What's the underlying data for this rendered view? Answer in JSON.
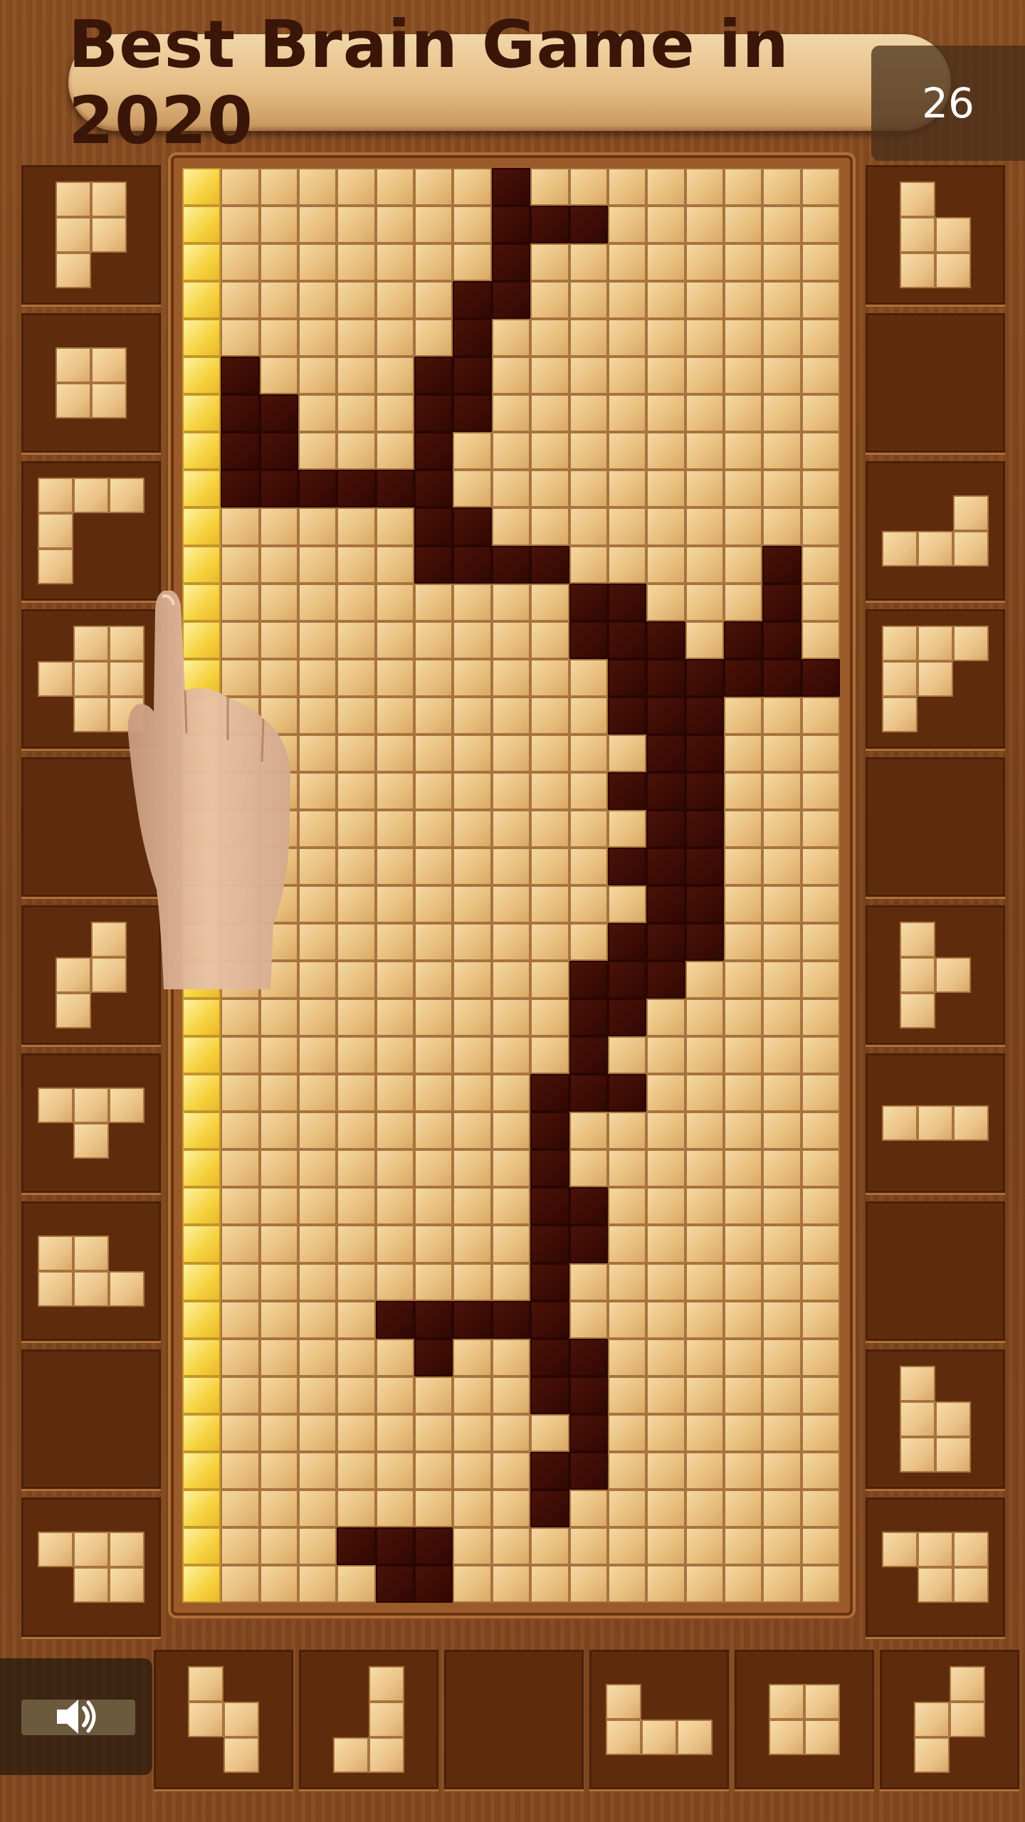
{
  "header": {
    "title": "Best Brain Game in 2020"
  },
  "counter": {
    "value": "26"
  },
  "board": {
    "cols": 17,
    "rows": 38,
    "rows_data": [
      "Y.......D........",
      "Y.......DDD......",
      "Y.......D........",
      "Y......DD........",
      "Y......D.........",
      "YD....DD.........",
      "YDD...DD.........",
      "YDD...D..........",
      "YDDDDDD..........",
      "Y.....DD.........",
      "Y.....DDDD.....D.",
      "Y.........DD...D.",
      "Y.........DDD.DD.",
      "Y..........DDDDDD",
      "Y..........DDD...",
      "Y...........DD...",
      "Y..........DDD...",
      "Y...........DD...",
      "Y..........DDD...",
      "Y...........DD...",
      "Y..........DDD...",
      "Y.........DDD....",
      "Y.........DD.....",
      "Y.........D......",
      "Y........DDD.....",
      "Y........D.......",
      "Y........D.......",
      "Y........DD......",
      "Y........DD......",
      "Y........D.......",
      "Y....DDDDD.......",
      "Y.....D..DD......",
      "Y........DD......",
      "Y.........D......",
      "Y........DD......",
      "Y........D.......",
      "Y...DDD..........",
      "Y....DD.........."
    ]
  },
  "left_tray": [
    {
      "name": "piece-p",
      "cells": [
        [
          0,
          0
        ],
        [
          1,
          0
        ],
        [
          0,
          1
        ],
        [
          1,
          1
        ],
        [
          0,
          2
        ]
      ]
    },
    {
      "name": "piece-square",
      "cells": [
        [
          0,
          0
        ],
        [
          1,
          0
        ],
        [
          0,
          1
        ],
        [
          1,
          1
        ]
      ]
    },
    {
      "name": "piece-big-l",
      "cells": [
        [
          0,
          0
        ],
        [
          1,
          0
        ],
        [
          2,
          0
        ],
        [
          0,
          1
        ],
        [
          0,
          2
        ]
      ]
    },
    {
      "name": "piece-plus",
      "cells": [
        [
          1,
          0
        ],
        [
          2,
          0
        ],
        [
          0,
          1
        ],
        [
          1,
          1
        ],
        [
          2,
          1
        ],
        [
          1,
          2
        ],
        [
          2,
          2
        ]
      ]
    },
    {
      "name": "empty",
      "cells": []
    },
    {
      "name": "piece-s-vert",
      "cells": [
        [
          1,
          0
        ],
        [
          0,
          1
        ],
        [
          1,
          1
        ],
        [
          0,
          2
        ]
      ]
    },
    {
      "name": "piece-t",
      "cells": [
        [
          0,
          0
        ],
        [
          1,
          0
        ],
        [
          2,
          0
        ],
        [
          1,
          1
        ]
      ]
    },
    {
      "name": "piece-p-flat",
      "cells": [
        [
          0,
          0
        ],
        [
          1,
          0
        ],
        [
          0,
          1
        ],
        [
          1,
          1
        ],
        [
          2,
          1
        ]
      ]
    },
    {
      "name": "empty",
      "cells": []
    },
    {
      "name": "piece-z-wide",
      "cells": [
        [
          0,
          0
        ],
        [
          1,
          0
        ],
        [
          2,
          0
        ],
        [
          1,
          1
        ],
        [
          2,
          1
        ]
      ]
    }
  ],
  "right_tray": [
    {
      "name": "piece-p",
      "cells": [
        [
          0,
          0
        ],
        [
          0,
          1
        ],
        [
          1,
          1
        ],
        [
          0,
          2
        ],
        [
          1,
          2
        ]
      ]
    },
    {
      "name": "empty",
      "cells": []
    },
    {
      "name": "piece-j-flat",
      "cells": [
        [
          2,
          0
        ],
        [
          0,
          1
        ],
        [
          1,
          1
        ],
        [
          2,
          1
        ]
      ]
    },
    {
      "name": "piece-big-l",
      "cells": [
        [
          0,
          0
        ],
        [
          1,
          0
        ],
        [
          2,
          0
        ],
        [
          0,
          1
        ],
        [
          1,
          1
        ],
        [
          0,
          2
        ]
      ]
    },
    {
      "name": "empty",
      "cells": []
    },
    {
      "name": "piece-t-vert",
      "cells": [
        [
          0,
          0
        ],
        [
          0,
          1
        ],
        [
          1,
          1
        ],
        [
          0,
          2
        ]
      ]
    },
    {
      "name": "piece-i3",
      "cells": [
        [
          0,
          0
        ],
        [
          1,
          0
        ],
        [
          2,
          0
        ]
      ]
    },
    {
      "name": "empty",
      "cells": []
    },
    {
      "name": "piece-p",
      "cells": [
        [
          0,
          0
        ],
        [
          0,
          1
        ],
        [
          1,
          1
        ],
        [
          0,
          2
        ],
        [
          1,
          2
        ]
      ]
    },
    {
      "name": "piece-z-wide",
      "cells": [
        [
          0,
          0
        ],
        [
          1,
          0
        ],
        [
          2,
          0
        ],
        [
          1,
          1
        ],
        [
          2,
          1
        ]
      ]
    }
  ],
  "bottom_tray": [
    {
      "name": "piece-z-vert",
      "cells": [
        [
          0,
          0
        ],
        [
          0,
          1
        ],
        [
          1,
          1
        ],
        [
          1,
          2
        ]
      ]
    },
    {
      "name": "piece-j",
      "cells": [
        [
          1,
          0
        ],
        [
          1,
          1
        ],
        [
          0,
          2
        ],
        [
          1,
          2
        ]
      ]
    },
    {
      "name": "empty",
      "cells": []
    },
    {
      "name": "piece-l-flat",
      "cells": [
        [
          0,
          0
        ],
        [
          0,
          1
        ],
        [
          1,
          1
        ],
        [
          2,
          1
        ]
      ]
    },
    {
      "name": "piece-square",
      "cells": [
        [
          0,
          0
        ],
        [
          1,
          0
        ],
        [
          0,
          1
        ],
        [
          1,
          1
        ]
      ]
    },
    {
      "name": "piece-s-vert",
      "cells": [
        [
          1,
          0
        ],
        [
          0,
          1
        ],
        [
          1,
          1
        ],
        [
          0,
          2
        ]
      ]
    }
  ],
  "colors": {
    "accent_yellow": "#f6d23f",
    "filled_dark": "#3a0b04",
    "empty_wood": "#ebc388"
  },
  "icons": {
    "sound": "speaker-icon",
    "hand": "pointing-hand-icon"
  }
}
